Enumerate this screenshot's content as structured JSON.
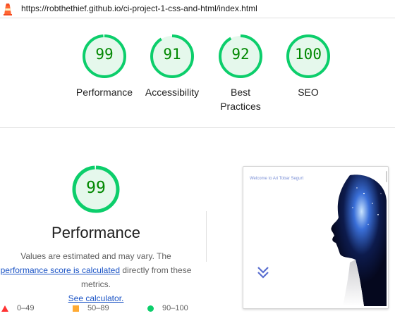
{
  "header": {
    "url": "https://robthethief.github.io/ci-project-1-css-and-html/index.html",
    "logo_icon": "lighthouse-icon"
  },
  "scores": [
    {
      "label": "Performance",
      "value": "99",
      "fraction": 0.99
    },
    {
      "label": "Accessibility",
      "value": "91",
      "fraction": 0.91
    },
    {
      "label": "Best Practices",
      "value": "92",
      "fraction": 0.92
    },
    {
      "label": "SEO",
      "value": "100",
      "fraction": 1.0
    }
  ],
  "performance": {
    "score": "99",
    "score_fraction": 0.99,
    "title": "Performance",
    "desc_1": "Values are estimated and may vary. The",
    "desc_link_1": "performance score is calculated",
    "desc_2": " directly from these metrics.",
    "desc_link_2": "See calculator."
  },
  "legend": {
    "fail": "0–49",
    "average": "50–89",
    "pass": "90–100"
  },
  "screenshot": {
    "welcome_text": "Welcome to Ari Tobar Segurt"
  },
  "colors": {
    "pass": "#0cce6b",
    "pass_text": "#008800",
    "pass_fill": "#e5f8ec",
    "average": "#ffaa33",
    "fail": "#ff3333",
    "link": "#1a53c5"
  }
}
